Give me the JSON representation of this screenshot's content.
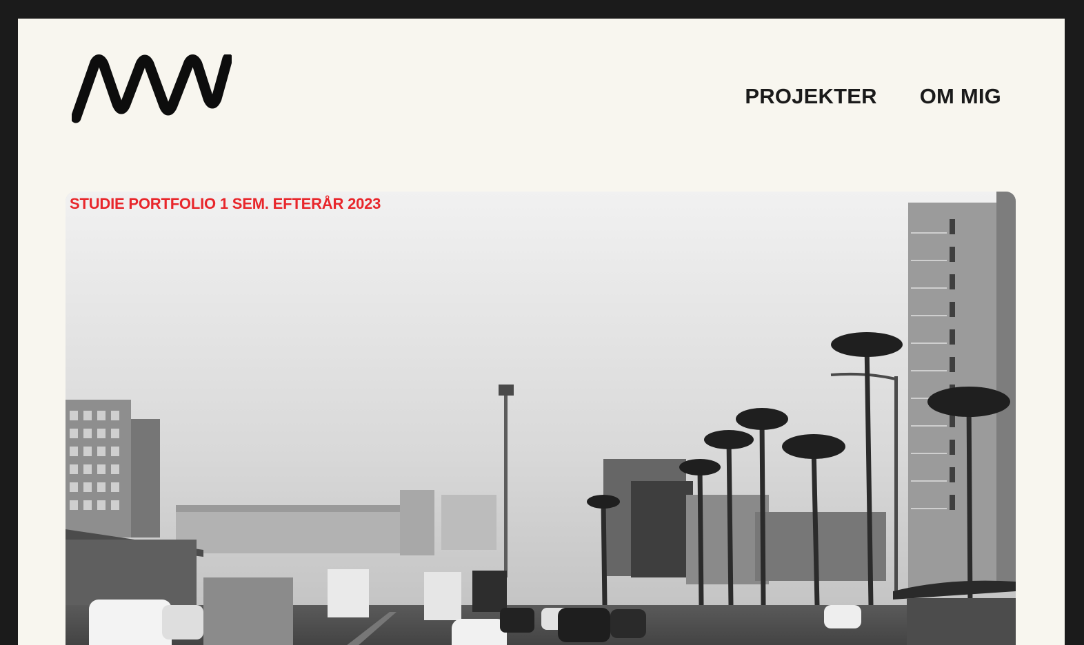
{
  "header": {
    "logo_alt": "MW",
    "nav": [
      {
        "label": "PROJEKTER"
      },
      {
        "label": "OM MIG"
      }
    ]
  },
  "hero": {
    "tagline": "STUDIE PORTFOLIO 1 SEM. EFTERÅR 2023",
    "image_description": "Black and white street photo with palm trees, buildings and traffic",
    "tagline_color": "#e8262b"
  },
  "colors": {
    "background": "#f8f6ef",
    "outer": "#1b1b1b",
    "text": "#1a1a1a"
  }
}
